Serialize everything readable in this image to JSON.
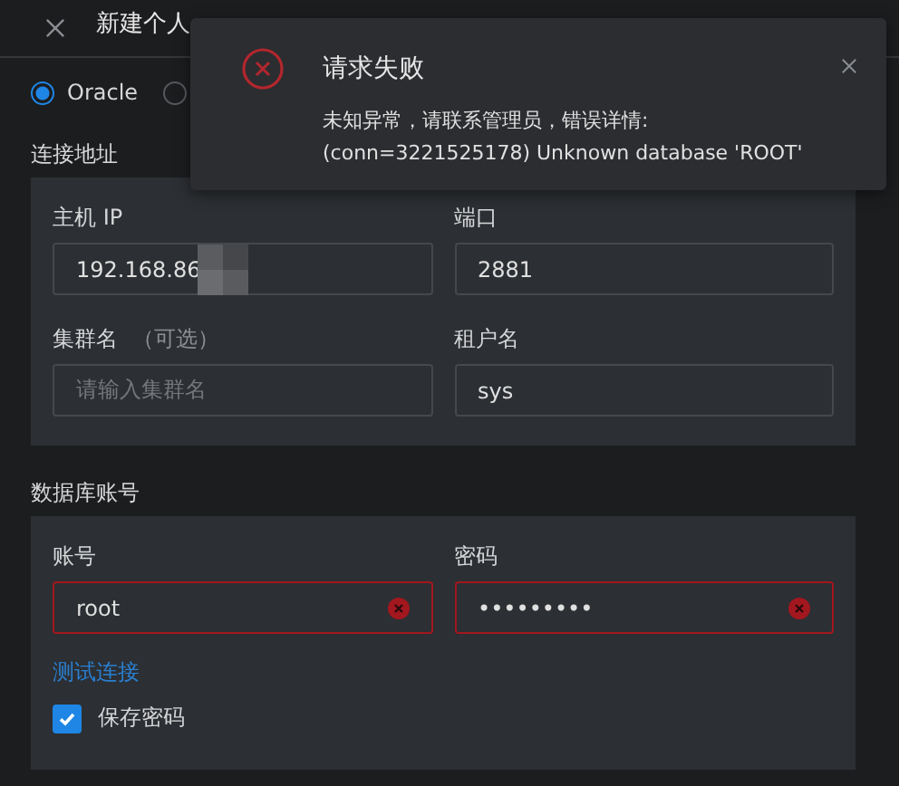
{
  "header": {
    "title": "新建个人"
  },
  "db_types": [
    {
      "label": "Oracle",
      "selected": true
    },
    {
      "selected": false
    }
  ],
  "address_section": {
    "title": "连接地址",
    "fields": [
      {
        "label": "主机 IP",
        "value": "192.168.86",
        "redacted": true
      },
      {
        "label": "端口",
        "value": "2881"
      },
      {
        "label": "集群名",
        "hint": "（可选）",
        "placeholder": "请输入集群名"
      },
      {
        "label": "租户名",
        "value": "sys"
      }
    ]
  },
  "account_section": {
    "title": "数据库账号",
    "fields": [
      {
        "label": "账号",
        "value": "root",
        "error": true
      },
      {
        "label": "密码",
        "value": "•••••••••",
        "error": true
      }
    ]
  },
  "test_link": "测试连接",
  "save_password": {
    "label": "保存密码",
    "checked": true
  },
  "toast": {
    "title": "请求失败",
    "lines": [
      "未知异常，请联系管理员，错误详情:",
      "(conn=3221525178) Unknown database 'ROOT'"
    ]
  }
}
